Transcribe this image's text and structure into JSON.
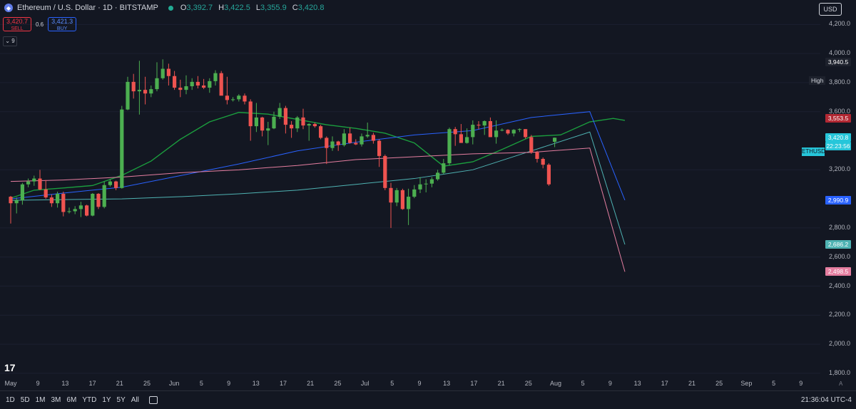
{
  "header": {
    "symbol_icon": "ethereum-icon",
    "title": "Ethereum / U.S. Dollar · 1D · BITSTAMP",
    "ohlc": [
      {
        "k": "O",
        "v": "3,392.7"
      },
      {
        "k": "H",
        "v": "3,422.5"
      },
      {
        "k": "L",
        "v": "3,355.9"
      },
      {
        "k": "C",
        "v": "3,420.8"
      }
    ]
  },
  "trade": {
    "sell_price": "3,420.7",
    "sell_label": "SELL",
    "spread": "0.6",
    "buy_price": "3,421.3",
    "buy_label": "BUY"
  },
  "indicators_toggle": "9",
  "currency_button": "USD",
  "y_axis": {
    "labels": [
      {
        "text": "4,200.0",
        "value": 4200
      },
      {
        "text": "4,000.0",
        "value": 4000
      },
      {
        "text": "3,800.0",
        "value": 3800
      },
      {
        "text": "3,600.0",
        "value": 3600
      },
      {
        "text": "3,200.0",
        "value": 3200
      },
      {
        "text": "2,800.0",
        "value": 2800
      },
      {
        "text": "2,600.0",
        "value": 2600
      },
      {
        "text": "2,400.0",
        "value": 2400
      },
      {
        "text": "2,200.0",
        "value": 2200
      },
      {
        "text": "2,000.0",
        "value": 2000
      },
      {
        "text": "1,800.0",
        "value": 1800
      }
    ]
  },
  "price_labels": {
    "high_label": "High",
    "high": {
      "text": "3,940.5",
      "value": 3940.5,
      "color": "#1e222d"
    },
    "ma_red": {
      "text": "3,553.5",
      "value": 3553.5,
      "color": "#b22833"
    },
    "symbol_tag": "ETHUSD",
    "last": {
      "text": "3,420.8",
      "value": 3420.8,
      "color": "#26c6da"
    },
    "countdown": "22:23:56",
    "ma_blue": {
      "text": "2,990.9",
      "value": 2990.9,
      "color": "#2962ff"
    },
    "ma_teal": {
      "text": "2,686.2",
      "value": 2686.2,
      "color": "#4fb3b3"
    },
    "ma_pink": {
      "text": "2,498.5",
      "value": 2498.5,
      "color": "#e57ea0"
    }
  },
  "x_axis": [
    "May",
    "9",
    "13",
    "17",
    "21",
    "25",
    "Jun",
    "5",
    "9",
    "13",
    "17",
    "21",
    "25",
    "Jul",
    "5",
    "9",
    "13",
    "17",
    "21",
    "25",
    "Aug",
    "5",
    "9",
    "13",
    "17",
    "21",
    "25",
    "Sep",
    "5",
    "9"
  ],
  "bottom_bar": {
    "ranges": [
      "1D",
      "5D",
      "1M",
      "3M",
      "6M",
      "YTD",
      "1Y",
      "5Y",
      "All"
    ],
    "clock": "21:36:04 UTC-4",
    "scale_mode": "A"
  },
  "chart_data": {
    "type": "candlestick",
    "colors": {
      "up": "#4caf50",
      "down": "#ef5350",
      "marker_dot": "#26d07c",
      "ma_green": "#1b9e3e",
      "ma_blue": "#2962ff",
      "ma_teal": "#4fb3b3",
      "ma_pink": "#e57ea0",
      "support": "#f2a33a",
      "trend": "#4dd0e1"
    },
    "ylim": [
      1780,
      4280
    ],
    "x_range": [
      "2024-05-01",
      "2024-09-10"
    ],
    "candles": [
      [
        "2024-05-01",
        3015,
        3020,
        2830,
        2970
      ],
      [
        "2024-05-02",
        2970,
        3010,
        2900,
        2990
      ],
      [
        "2024-05-03",
        2990,
        3110,
        2960,
        3100
      ],
      [
        "2024-05-04",
        3100,
        3140,
        3080,
        3120
      ],
      [
        "2024-05-05",
        3120,
        3160,
        3090,
        3140
      ],
      [
        "2024-05-06",
        3140,
        3200,
        3060,
        3065
      ],
      [
        "2024-05-07",
        3065,
        3130,
        3000,
        3010
      ],
      [
        "2024-05-08",
        3010,
        3030,
        2945,
        2970
      ],
      [
        "2024-05-09",
        2970,
        3050,
        2940,
        3035
      ],
      [
        "2024-05-10",
        3035,
        3050,
        2880,
        2910
      ],
      [
        "2024-05-11",
        2910,
        2940,
        2900,
        2915
      ],
      [
        "2024-05-12",
        2915,
        2950,
        2895,
        2930
      ],
      [
        "2024-05-13",
        2930,
        2980,
        2875,
        2955
      ],
      [
        "2024-05-14",
        2955,
        2960,
        2880,
        2885
      ],
      [
        "2024-05-15",
        2885,
        3040,
        2880,
        3035
      ],
      [
        "2024-05-16",
        3035,
        3040,
        2930,
        2945
      ],
      [
        "2024-05-17",
        2945,
        3120,
        2935,
        3095
      ],
      [
        "2024-05-18",
        3095,
        3135,
        3085,
        3120
      ],
      [
        "2024-05-19",
        3120,
        3125,
        3060,
        3075
      ],
      [
        "2024-05-20",
        3075,
        3640,
        3070,
        3615
      ],
      [
        "2024-05-21",
        3615,
        3840,
        3610,
        3805
      ],
      [
        "2024-05-22",
        3805,
        3860,
        3690,
        3740
      ],
      [
        "2024-05-23",
        3740,
        3950,
        3580,
        3750
      ],
      [
        "2024-05-24",
        3750,
        3840,
        3650,
        3725
      ],
      [
        "2024-05-25",
        3725,
        3780,
        3700,
        3755
      ],
      [
        "2024-05-26",
        3755,
        3940,
        3740,
        3830
      ],
      [
        "2024-05-27",
        3830,
        3960,
        3820,
        3895
      ],
      [
        "2024-05-28",
        3895,
        3930,
        3780,
        3845
      ],
      [
        "2024-05-29",
        3845,
        3880,
        3750,
        3765
      ],
      [
        "2024-05-30",
        3765,
        3820,
        3700,
        3750
      ],
      [
        "2024-05-31",
        3750,
        3850,
        3720,
        3775
      ],
      [
        "2024-06-01",
        3775,
        3830,
        3750,
        3805
      ],
      [
        "2024-06-02",
        3805,
        3845,
        3760,
        3780
      ],
      [
        "2024-06-03",
        3780,
        3825,
        3755,
        3765
      ],
      [
        "2024-06-04",
        3765,
        3830,
        3730,
        3810
      ],
      [
        "2024-06-05",
        3810,
        3885,
        3780,
        3865
      ],
      [
        "2024-06-06",
        3865,
        3880,
        3745,
        3710
      ],
      [
        "2024-06-07",
        3710,
        3840,
        3650,
        3680
      ],
      [
        "2024-06-08",
        3680,
        3700,
        3670,
        3685
      ],
      [
        "2024-06-09",
        3685,
        3720,
        3670,
        3710
      ],
      [
        "2024-06-10",
        3710,
        3725,
        3650,
        3670
      ],
      [
        "2024-06-11",
        3670,
        3685,
        3400,
        3500
      ],
      [
        "2024-06-12",
        3500,
        3660,
        3460,
        3560
      ],
      [
        "2024-06-13",
        3560,
        3565,
        3430,
        3470
      ],
      [
        "2024-06-14",
        3470,
        3530,
        3370,
        3485
      ],
      [
        "2024-06-15",
        3485,
        3600,
        3480,
        3565
      ],
      [
        "2024-06-16",
        3565,
        3660,
        3550,
        3625
      ],
      [
        "2024-06-17",
        3625,
        3640,
        3450,
        3510
      ],
      [
        "2024-06-18",
        3510,
        3535,
        3420,
        3485
      ],
      [
        "2024-06-19",
        3485,
        3570,
        3460,
        3560
      ],
      [
        "2024-06-20",
        3560,
        3620,
        3480,
        3505
      ],
      [
        "2024-06-21",
        3505,
        3520,
        3400,
        3515
      ],
      [
        "2024-06-22",
        3515,
        3525,
        3490,
        3500
      ],
      [
        "2024-06-23",
        3500,
        3510,
        3410,
        3420
      ],
      [
        "2024-06-24",
        3420,
        3430,
        3240,
        3350
      ],
      [
        "2024-06-25",
        3350,
        3430,
        3330,
        3395
      ],
      [
        "2024-06-26",
        3395,
        3400,
        3330,
        3370
      ],
      [
        "2024-06-27",
        3370,
        3480,
        3360,
        3450
      ],
      [
        "2024-06-28",
        3450,
        3490,
        3380,
        3385
      ],
      [
        "2024-06-29",
        3385,
        3410,
        3370,
        3375
      ],
      [
        "2024-06-30",
        3375,
        3450,
        3360,
        3430
      ],
      [
        "2024-07-01",
        3430,
        3525,
        3420,
        3440
      ],
      [
        "2024-07-02",
        3440,
        3455,
        3380,
        3400
      ],
      [
        "2024-07-03",
        3400,
        3410,
        3220,
        3295
      ],
      [
        "2024-07-04",
        3295,
        3305,
        3060,
        3075
      ],
      [
        "2024-07-05",
        3075,
        3110,
        2800,
        2975
      ],
      [
        "2024-07-06",
        2975,
        3075,
        2950,
        3060
      ],
      [
        "2024-07-07",
        3060,
        3070,
        2925,
        2930
      ],
      [
        "2024-07-08",
        2930,
        3070,
        2820,
        3015
      ],
      [
        "2024-07-09",
        3015,
        3095,
        3005,
        3065
      ],
      [
        "2024-07-10",
        3065,
        3150,
        3040,
        3100
      ],
      [
        "2024-07-11",
        3100,
        3135,
        3045,
        3105
      ],
      [
        "2024-07-12",
        3105,
        3150,
        3080,
        3135
      ],
      [
        "2024-07-13",
        3135,
        3200,
        3125,
        3180
      ],
      [
        "2024-07-14",
        3180,
        3275,
        3170,
        3245
      ],
      [
        "2024-07-15",
        3245,
        3490,
        3230,
        3480
      ],
      [
        "2024-07-16",
        3480,
        3495,
        3365,
        3445
      ],
      [
        "2024-07-17",
        3445,
        3515,
        3385,
        3385
      ],
      [
        "2024-07-18",
        3385,
        3485,
        3380,
        3425
      ],
      [
        "2024-07-19",
        3425,
        3540,
        3375,
        3510
      ],
      [
        "2024-07-20",
        3510,
        3535,
        3480,
        3505
      ],
      [
        "2024-07-21",
        3505,
        3540,
        3440,
        3535
      ],
      [
        "2024-07-22",
        3535,
        3560,
        3425,
        3425
      ],
      [
        "2024-07-23",
        3425,
        3540,
        3380,
        3470
      ],
      [
        "2024-07-24",
        3470,
        3485,
        3465,
        3475
      ],
      [
        "2024-07-25",
        3475,
        3480,
        3440,
        3450
      ],
      [
        "2024-07-26",
        3450,
        3480,
        3430,
        3475
      ],
      [
        "2024-07-27",
        3475,
        3485,
        3460,
        3480
      ],
      [
        "2024-07-28",
        3480,
        3480,
        3415,
        3425
      ],
      [
        "2024-07-29",
        3425,
        3440,
        3310,
        3320
      ],
      [
        "2024-07-30",
        3320,
        3330,
        3250,
        3275
      ],
      [
        "2024-07-31",
        3275,
        3285,
        3210,
        3235
      ],
      [
        "2024-08-01",
        3235,
        3245,
        3090,
        3100
      ],
      [
        "2024-08-02",
        3392.7,
        3422.5,
        3355.9,
        3420.8
      ]
    ],
    "moving_averages": [
      {
        "color": "#1b9e3e",
        "values": [
          [
            1,
            3005
          ],
          [
            5,
            3060
          ],
          [
            10,
            3075
          ],
          [
            15,
            3092
          ],
          [
            20,
            3162
          ],
          [
            25,
            3260
          ],
          [
            30,
            3410
          ],
          [
            35,
            3530
          ],
          [
            40,
            3595
          ],
          [
            45,
            3583
          ],
          [
            50,
            3547
          ],
          [
            55,
            3510
          ],
          [
            60,
            3485
          ],
          [
            65,
            3452
          ],
          [
            70,
            3385
          ],
          [
            75,
            3225
          ],
          [
            80,
            3255
          ],
          [
            85,
            3340
          ],
          [
            90,
            3430
          ],
          [
            95,
            3440
          ],
          [
            100,
            3530
          ],
          [
            104,
            3553.5
          ],
          [
            106,
            3540
          ]
        ]
      },
      {
        "color": "#2962ff",
        "values": [
          [
            1,
            3000
          ],
          [
            10,
            3040
          ],
          [
            20,
            3080
          ],
          [
            30,
            3160
          ],
          [
            40,
            3240
          ],
          [
            50,
            3330
          ],
          [
            60,
            3390
          ],
          [
            70,
            3440
          ],
          [
            80,
            3470
          ],
          [
            90,
            3560
          ],
          [
            100,
            3600
          ],
          [
            106,
            2990.9
          ]
        ]
      },
      {
        "color": "#4fb3b3",
        "values": [
          [
            1,
            2990
          ],
          [
            10,
            2995
          ],
          [
            20,
            3000
          ],
          [
            30,
            3015
          ],
          [
            40,
            3035
          ],
          [
            50,
            3060
          ],
          [
            60,
            3100
          ],
          [
            70,
            3140
          ],
          [
            80,
            3200
          ],
          [
            90,
            3330
          ],
          [
            100,
            3460
          ],
          [
            106,
            2686.2
          ]
        ]
      },
      {
        "color": "#e57ea0",
        "values": [
          [
            1,
            3120
          ],
          [
            10,
            3130
          ],
          [
            20,
            3150
          ],
          [
            30,
            3180
          ],
          [
            40,
            3200
          ],
          [
            50,
            3230
          ],
          [
            60,
            3270
          ],
          [
            70,
            3290
          ],
          [
            80,
            3310
          ],
          [
            90,
            3320
          ],
          [
            100,
            3350
          ],
          [
            106,
            2498.5
          ]
        ]
      }
    ],
    "annotations": [
      {
        "text": "R",
        "color": "#f5d742"
      },
      {
        "text": "T",
        "color": "#f0a23a"
      },
      {
        "text": "R",
        "color": "#26c6da"
      }
    ]
  }
}
